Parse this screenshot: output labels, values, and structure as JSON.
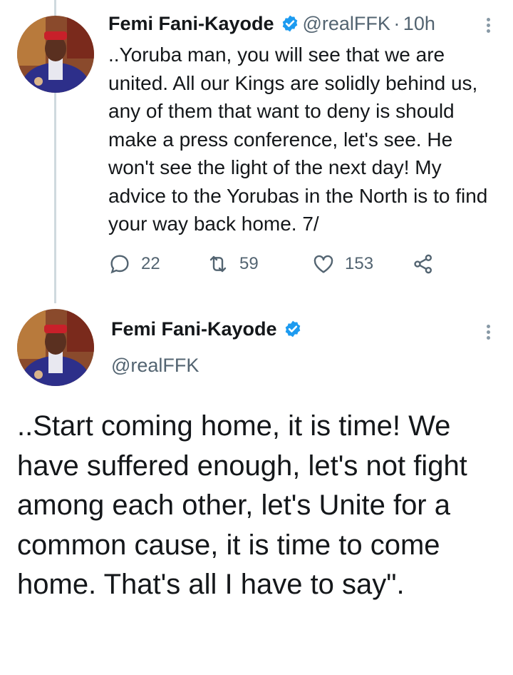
{
  "tweet1": {
    "display_name": "Femi Fani-Kayode",
    "handle": "@realFFK",
    "time_separator": "·",
    "time": "10h",
    "text": "..Yoruba man, you will see that we are united. All our Kings are solidly behind us, any of them that want to deny is should make a press conference, let's see. He won't see the light of the next day! My advice to the Yorubas in the North is to find your way back home. 7/",
    "actions": {
      "reply_count": "22",
      "retweet_count": "59",
      "like_count": "153"
    }
  },
  "tweet2": {
    "display_name": "Femi Fani-Kayode",
    "handle": "@realFFK",
    "text": "..Start coming home, it is time! We have suffered enough, let's not fight among each other, let's Unite for a common cause, it is time to come home. That's all I have to say\"."
  },
  "colors": {
    "verified": "#1d9bf0",
    "secondary_text": "#536471",
    "thread_line": "#cfd9de"
  },
  "icons": [
    "verified-badge-icon",
    "more-options-icon",
    "reply-icon",
    "retweet-icon",
    "like-icon",
    "share-icon"
  ]
}
